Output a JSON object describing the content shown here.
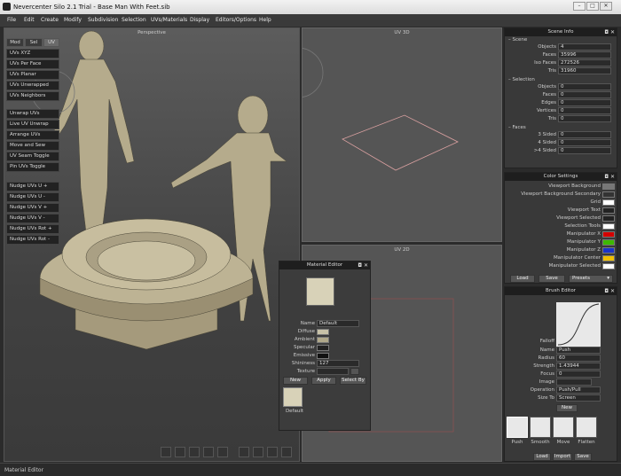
{
  "window": {
    "title": "Nevercenter Silo 2.1 Trial - Base Man With Feet.sib"
  },
  "menu": [
    "File",
    "Edit",
    "Create",
    "Modify",
    "Subdivision",
    "Selection",
    "UVs/Materials",
    "Display",
    "Editors/Options",
    "Help"
  ],
  "viewports": {
    "perspective": "Perspective",
    "uv3d": "UV 3D",
    "uv2d": "UV 2D"
  },
  "modes": [
    "Mod",
    "Sel",
    "UV"
  ],
  "uv_tools_1": [
    "UVs XYZ",
    "UVs Per Face",
    "UVs Planar",
    "UVs Unwrapped",
    "UVs Neighbors"
  ],
  "uv_tools_2": [
    "Unwrap UVs",
    "Live UV Unwrap",
    "Arrange UVs",
    "Move and Sew",
    "UV Seam Toggle",
    "Pin UVs Toggle"
  ],
  "uv_tools_3": [
    "Nudge UVs U +",
    "Nudge UVs U -",
    "Nudge UVs V +",
    "Nudge UVs V -",
    "Nudge UVs Rot +",
    "Nudge UVs Rot -"
  ],
  "scene_info": {
    "title": "Scene Info",
    "scene": {
      "label": "Scene",
      "rows": [
        [
          "Objects",
          "4"
        ],
        [
          "Faces",
          "35996"
        ],
        [
          "Iso Faces",
          "272526"
        ],
        [
          "Tris",
          "31960"
        ]
      ]
    },
    "selection": {
      "label": "Selection",
      "rows": [
        [
          "Objects",
          "0"
        ],
        [
          "Faces",
          "0"
        ],
        [
          "Edges",
          "0"
        ],
        [
          "Vertices",
          "0"
        ],
        [
          "Tris",
          "0"
        ]
      ]
    },
    "faces": {
      "label": "Faces",
      "rows": [
        [
          "3 Sided",
          "0"
        ],
        [
          "4 Sided",
          "0"
        ],
        [
          ">4 Sided",
          "0"
        ]
      ]
    }
  },
  "color_settings": {
    "title": "Color Settings",
    "rows": [
      [
        "Viewport Background",
        "#777777"
      ],
      [
        "Viewport Background Secondary",
        "#333333"
      ],
      [
        "Grid",
        "#ffffff"
      ],
      [
        "Viewport Text",
        "#222222"
      ],
      [
        "Viewport Selected",
        "#222222"
      ],
      [
        "Selection Tools",
        "#ffffff"
      ],
      [
        "Manipulator X",
        "#d40000"
      ],
      [
        "Manipulator Y",
        "#3db800"
      ],
      [
        "Manipulator Z",
        "#1a33c8"
      ],
      [
        "Manipulator Center",
        "#f0c000"
      ],
      [
        "Manipulator Selected",
        "#ffffff"
      ]
    ],
    "load": "Load",
    "save": "Save",
    "presets": "Presets"
  },
  "brush_editor": {
    "title": "Brush Editor",
    "falloff": "Falloff",
    "name_label": "Name",
    "name": "Push",
    "radius_label": "Radius",
    "radius": "60",
    "strength_label": "Strength",
    "strength": "1.43944",
    "focus_label": "Focus",
    "focus": "0",
    "image_label": "Image",
    "operation_label": "Operation",
    "operation": "Push/Pull",
    "sizeto_label": "Size To",
    "sizeto": "Screen",
    "new": "New",
    "brushes": [
      "Push",
      "Smooth",
      "Move",
      "Flatten"
    ],
    "load": "Load",
    "import": "Import",
    "save": "Save"
  },
  "material_editor": {
    "title": "Material Editor",
    "name_label": "Name",
    "name": "Default",
    "props": [
      [
        "Diffuse",
        "#c8c2a8"
      ],
      [
        "Ambient",
        "#b0a88a"
      ],
      [
        "Specular",
        "#222222"
      ],
      [
        "Emissive",
        "#111111"
      ]
    ],
    "shininess_label": "Shininess",
    "shininess": "127",
    "texture_label": "Texture",
    "new": "New",
    "apply": "Apply",
    "select_by": "Select By",
    "swatch_label": "Default"
  },
  "status": "Material Editor"
}
